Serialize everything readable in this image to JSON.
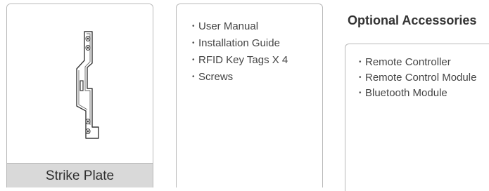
{
  "product": {
    "caption": "Strike Plate"
  },
  "contents": {
    "items": [
      "User Manual",
      "Installation Guide",
      "RFID Key Tags X 4",
      "Screws"
    ]
  },
  "accessories": {
    "title": "Optional Accessories",
    "items": [
      "Remote Controller",
      "Remote Control Module",
      "Bluetooth Module"
    ]
  },
  "colors": {
    "border": "#b9b9b9",
    "caption_background": "#d9d9d9",
    "text": "#444444"
  }
}
